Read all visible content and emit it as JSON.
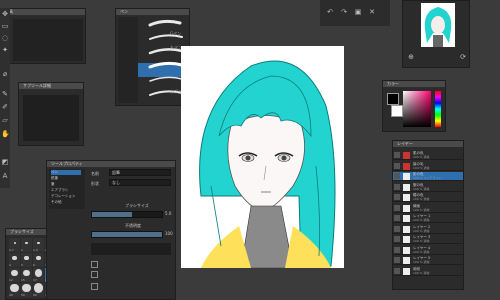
{
  "colors": {
    "bg": "#3b3b3b",
    "panel": "#2b2b2b",
    "title": "#4a4a4a",
    "hair": "#22d3d0",
    "accent": "#2f6fad",
    "yellow": "#ffe05a"
  },
  "tool_panel": {
    "title": "道具"
  },
  "subtool_panel": {
    "title": "ペン"
  },
  "brushsize_panel": {
    "title": "ブラシサイズ",
    "sizes": [
      "0.7",
      "1",
      "1.5",
      "2",
      "2.5",
      "3",
      "4",
      "5",
      "6",
      "7",
      "8",
      "10",
      "12",
      "15",
      "17",
      "20",
      "25",
      "30",
      "40",
      "50",
      "60",
      "70",
      "80",
      "100"
    ]
  },
  "color_panel": {
    "title": "カラー"
  },
  "navigator": {
    "title": "ナビゲーター"
  },
  "layer_panel": {
    "title": "レイヤー",
    "layers": [
      {
        "name": "肌の色",
        "meta": "100 % 通常"
      },
      {
        "name": "髪の毛",
        "meta": "100 % 通常"
      },
      {
        "name": "影の色",
        "meta": "100 % リニアライト"
      },
      {
        "name": "服の色",
        "meta": "100 % 通常"
      },
      {
        "name": "瞳の色",
        "meta": "100 % 通常"
      },
      {
        "name": "線画",
        "meta": "100 % 通常"
      },
      {
        "name": "レイヤー 1",
        "meta": "100 % 通常"
      },
      {
        "name": "レイヤー 2",
        "meta": "100 % 通常"
      },
      {
        "name": "レイヤー 3",
        "meta": "100 % 通常"
      },
      {
        "name": "レイヤー 4",
        "meta": "100 % 通常"
      },
      {
        "name": "レイヤー 5",
        "meta": "100 % 通常"
      },
      {
        "name": "用紙",
        "meta": "100 % 通常"
      }
    ]
  },
  "tool_property": {
    "title": "ツールプロパティ",
    "name_label": "名前",
    "name_value": "鉛筆",
    "shape_label": "形状",
    "shape_value": "なし",
    "brush_size_label": "ブラシサイズ",
    "opacity_label": "不透明度",
    "opacity_value": "100",
    "slider1_value": "5.0",
    "categories": [
      "ペン",
      "鉛筆",
      "筆",
      "エアブラシ",
      "デコレーション",
      "その他"
    ]
  },
  "small_panel": {
    "title": "サブツール詳細"
  },
  "brush_strokes": {
    "labels": [
      "Gペン",
      "丸ペン",
      "カブラペン",
      "ミリペン",
      "サインペン"
    ]
  }
}
